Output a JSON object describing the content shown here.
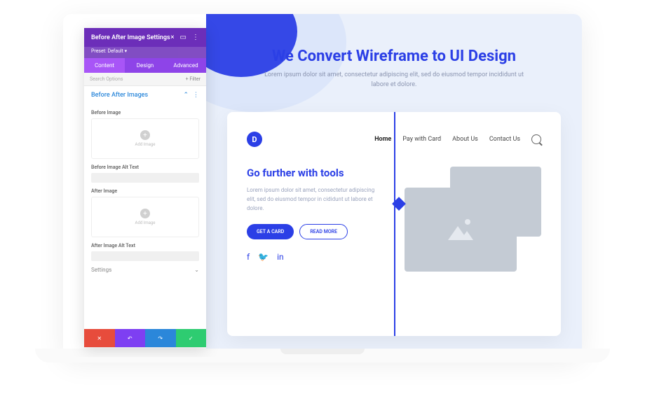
{
  "panel": {
    "title": "Before After Image Settings",
    "preset": "Preset: Default",
    "tabs": [
      "Content",
      "Design",
      "Advanced"
    ],
    "search_placeholder": "Search Options",
    "filter_label": "+ Filter",
    "section_title": "Before After Images",
    "fields": {
      "before_image_label": "Before Image",
      "add_image_text": "Add Image",
      "before_alt_label": "Before Image Alt Text",
      "after_image_label": "After Image",
      "after_alt_label": "After Image Alt Text"
    },
    "settings_label": "Settings"
  },
  "preview": {
    "hero_title": "We Convert Wireframe to UI Design",
    "hero_sub": "Lorem ipsum dolor sit amet, consectetur adipiscing elit, sed do eiusmod tempor incididunt ut labore et dolore.",
    "logo_letter": "D",
    "nav": [
      "Home",
      "Pay with Card",
      "About Us",
      "Contact Us"
    ],
    "card_heading": "Go further with tools",
    "card_text": "Lorem ipsum dolor sit amet, consectetur adipiscing elit, sed do eiusmod tempor in cididunt ut labore et dolore.",
    "btn_primary": "GET A CARD",
    "btn_outline": "READ MORE"
  }
}
